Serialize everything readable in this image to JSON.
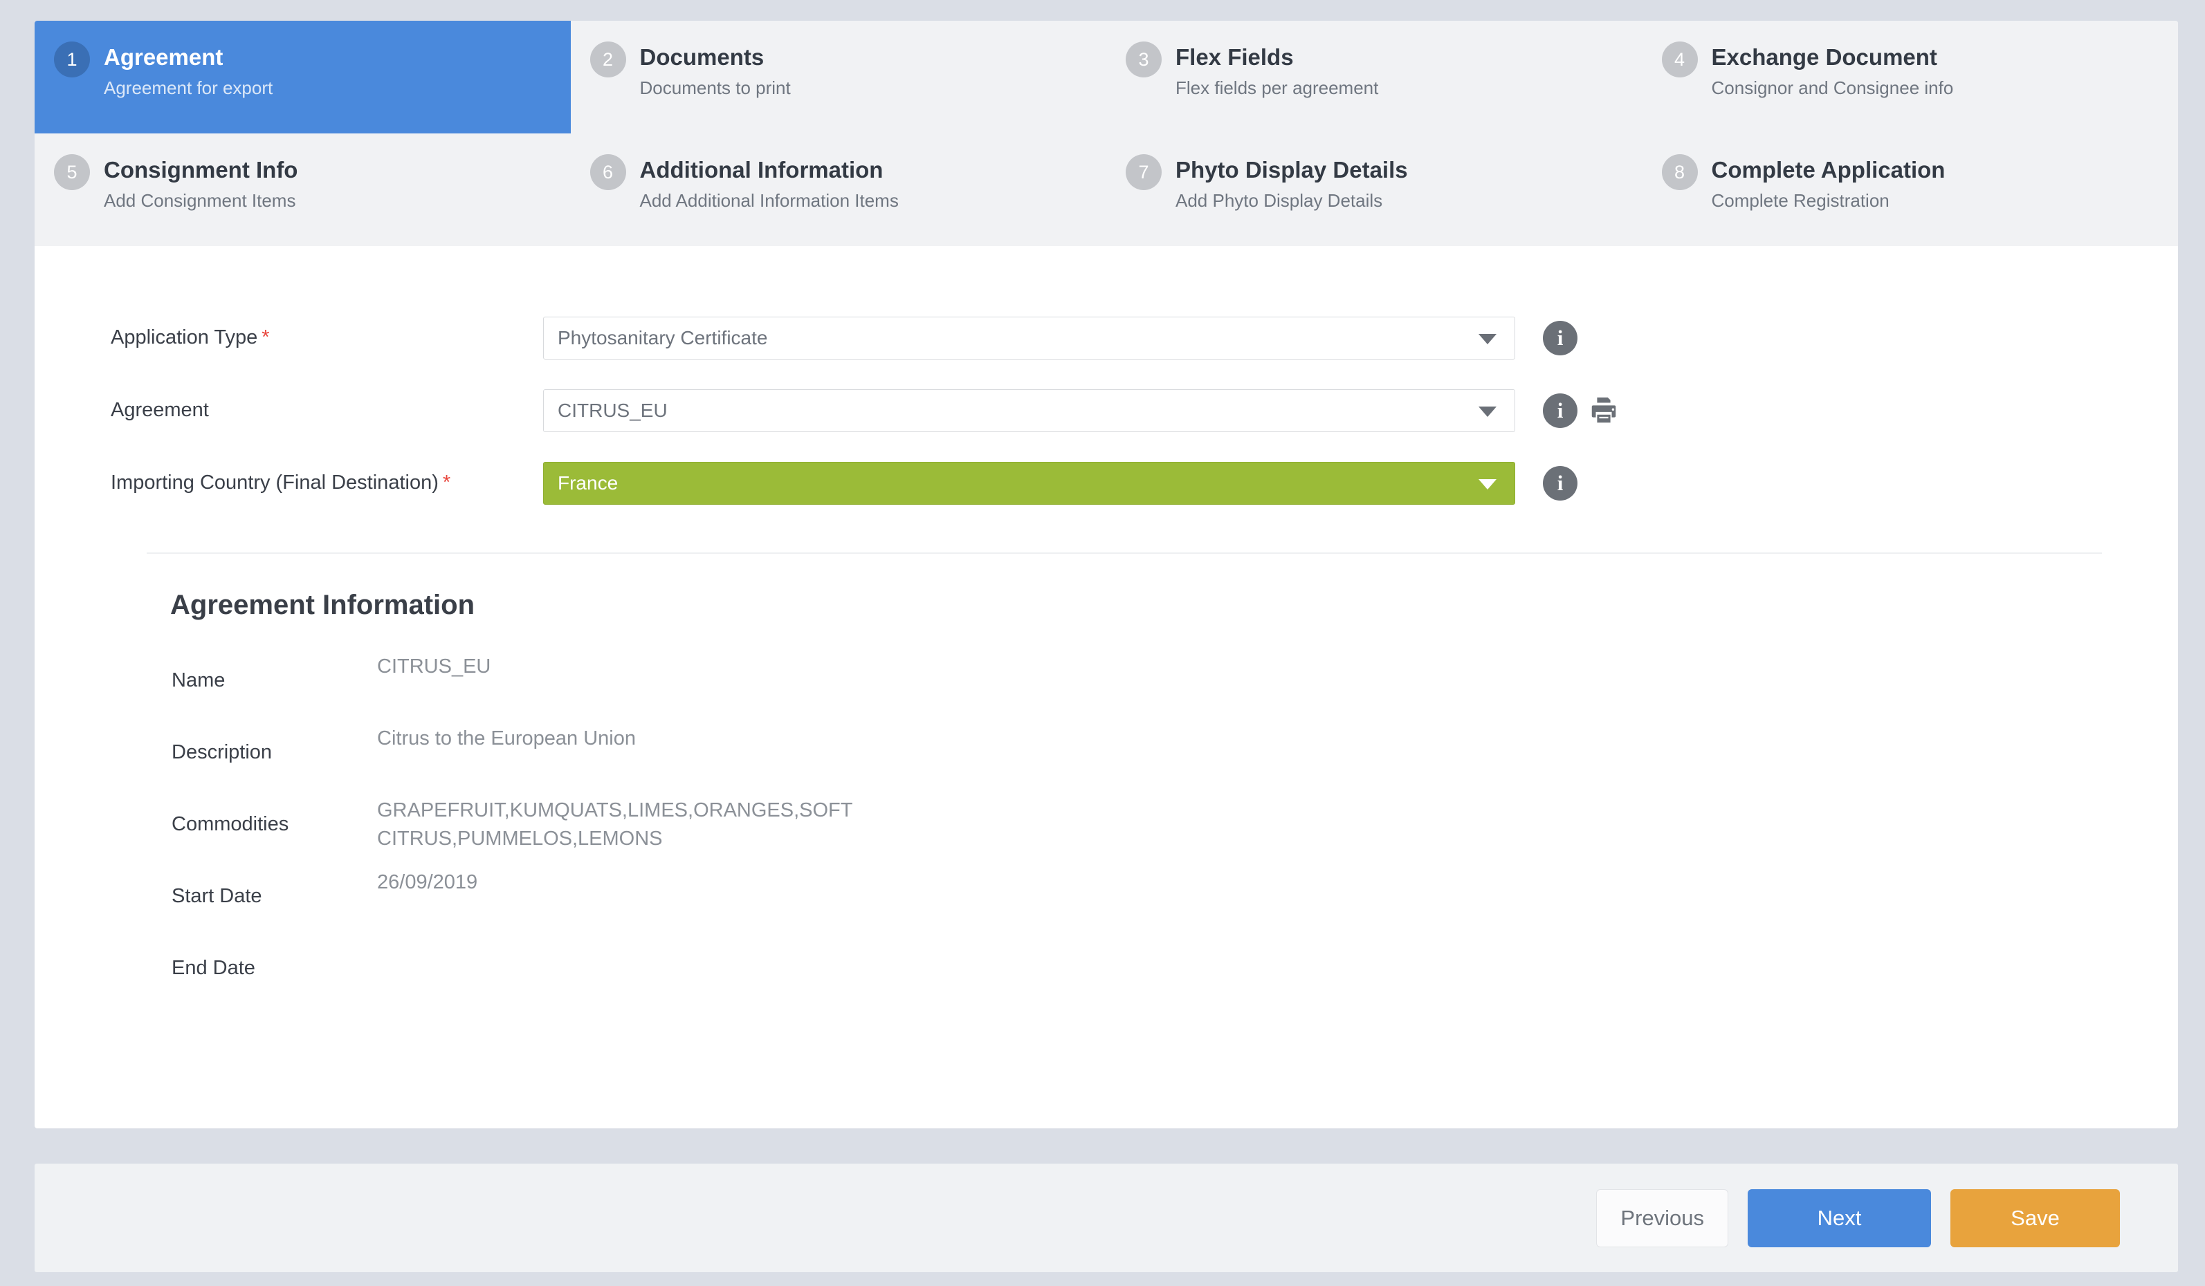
{
  "stepper": {
    "steps": [
      {
        "number": "1",
        "title": "Agreement",
        "subtitle": "Agreement for export",
        "active": true
      },
      {
        "number": "2",
        "title": "Documents",
        "subtitle": "Documents to print",
        "active": false
      },
      {
        "number": "3",
        "title": "Flex Fields",
        "subtitle": "Flex fields per agreement",
        "active": false
      },
      {
        "number": "4",
        "title": "Exchange Document",
        "subtitle": "Consignor and Consignee info",
        "active": false
      },
      {
        "number": "5",
        "title": "Consignment Info",
        "subtitle": "Add Consignment Items",
        "active": false
      },
      {
        "number": "6",
        "title": "Additional Information",
        "subtitle": "Add Additional Information Items",
        "active": false
      },
      {
        "number": "7",
        "title": "Phyto Display Details",
        "subtitle": "Add Phyto Display Details",
        "active": false
      },
      {
        "number": "8",
        "title": "Complete Application",
        "subtitle": "Complete Registration",
        "active": false
      }
    ]
  },
  "form": {
    "application_type": {
      "label": "Application Type",
      "required_mark": "*",
      "value": "Phytosanitary Certificate",
      "info_icon": "info-icon"
    },
    "agreement": {
      "label": "Agreement",
      "value": "CITRUS_EU",
      "info_icon": "info-icon",
      "print_icon": "printer-icon"
    },
    "importing_country": {
      "label": "Importing Country (Final Destination)",
      "required_mark": "*",
      "value": "France",
      "info_icon": "info-icon"
    }
  },
  "agreement_information": {
    "heading": "Agreement Information",
    "rows": [
      {
        "label": "Name",
        "value": "CITRUS_EU"
      },
      {
        "label": "Description",
        "value": "Citrus to the European Union"
      },
      {
        "label": "Commodities",
        "value": "GRAPEFRUIT,KUMQUATS,LIMES,ORANGES,SOFT CITRUS,PUMMELOS,LEMONS"
      },
      {
        "label": "Start Date",
        "value": "26/09/2019"
      },
      {
        "label": "End Date",
        "value": ""
      }
    ]
  },
  "footer": {
    "previous_label": "Previous",
    "next_label": "Next",
    "save_label": "Save"
  },
  "colors": {
    "accent_blue": "#4a89dc",
    "accent_green": "#9bbb38",
    "accent_orange": "#e8a33d",
    "page_background": "#dadee6",
    "tab_inactive": "#f1f2f4",
    "required_red": "#e8453c"
  }
}
